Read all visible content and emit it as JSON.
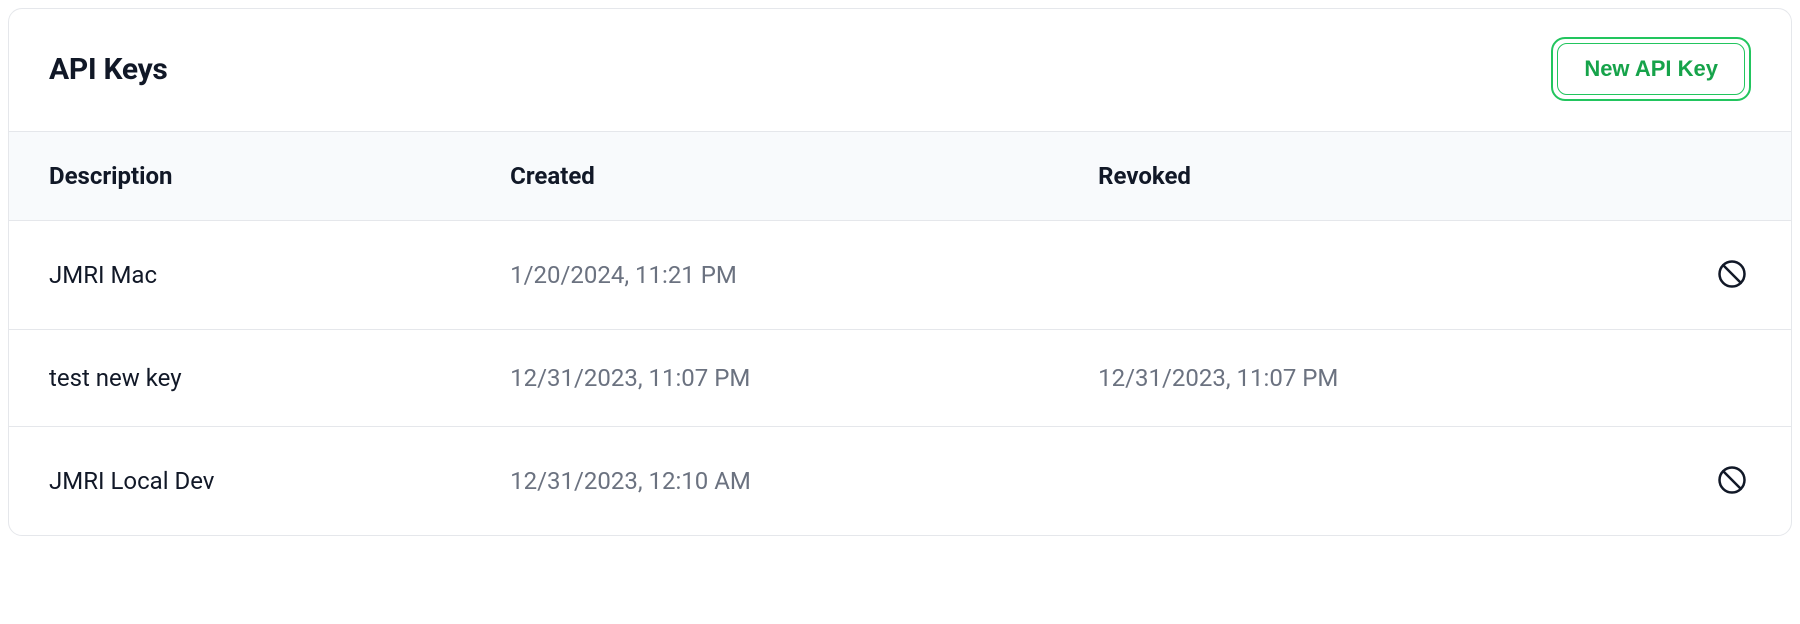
{
  "header": {
    "title": "API Keys",
    "new_button_label": "New API Key"
  },
  "columns": {
    "description": "Description",
    "created": "Created",
    "revoked": "Revoked"
  },
  "rows": [
    {
      "description": "JMRI Mac",
      "created": "1/20/2024, 11:21 PM",
      "revoked": "",
      "can_revoke": true
    },
    {
      "description": "test new key",
      "created": "12/31/2023, 11:07 PM",
      "revoked": "12/31/2023, 11:07 PM",
      "can_revoke": false
    },
    {
      "description": "JMRI Local Dev",
      "created": "12/31/2023, 12:10 AM",
      "revoked": "",
      "can_revoke": true
    }
  ]
}
